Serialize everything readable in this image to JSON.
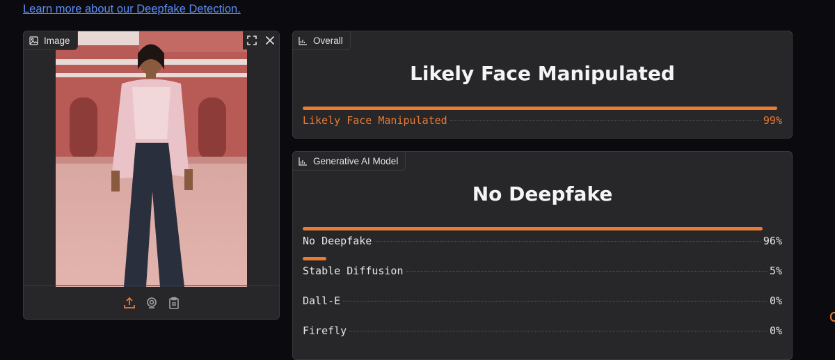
{
  "link": {
    "text": "Learn more about our Deepfake Detection."
  },
  "image_panel": {
    "tag_label": "Image",
    "fullscreen_icon": "fullscreen-icon",
    "close_icon": "close-icon",
    "footer_icons": [
      "upload-icon",
      "webcam-icon",
      "clipboard-icon"
    ]
  },
  "overall": {
    "tag_label": "Overall",
    "headline": "Likely Face Manipulated",
    "results": [
      {
        "label": "Likely Face Manipulated",
        "percent": "99%",
        "fill": 0.99,
        "highlight": true
      }
    ]
  },
  "genai": {
    "tag_label": "Generative AI Model",
    "headline": "No Deepfake",
    "results": [
      {
        "label": "No Deepfake",
        "percent": "96%",
        "fill": 0.96
      },
      {
        "label": "Stable Diffusion",
        "percent": "5%",
        "fill": 0.05
      },
      {
        "label": "Dall-E",
        "percent": "0%",
        "fill": 0.0
      },
      {
        "label": "Firefly",
        "percent": "0%",
        "fill": 0.0
      }
    ]
  },
  "colors": {
    "accent": "#ea7b32",
    "link": "#5b8cf5",
    "panel": "#27272a"
  }
}
